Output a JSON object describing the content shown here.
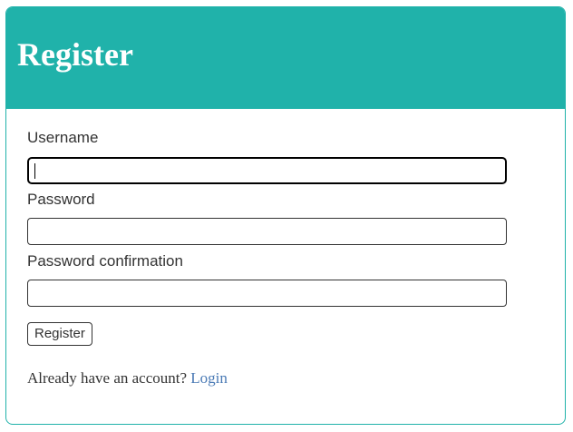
{
  "header": {
    "title": "Register"
  },
  "form": {
    "username": {
      "label": "Username",
      "value": "",
      "placeholder": ""
    },
    "password": {
      "label": "Password",
      "value": "",
      "placeholder": ""
    },
    "password_confirmation": {
      "label": "Password confirmation",
      "value": "",
      "placeholder": ""
    },
    "submit_label": "Register"
  },
  "footer": {
    "prompt": "Already have an account?",
    "login_label": "Login"
  },
  "colors": {
    "header_bg": "#20b2aa",
    "link": "#4a7ab5"
  }
}
